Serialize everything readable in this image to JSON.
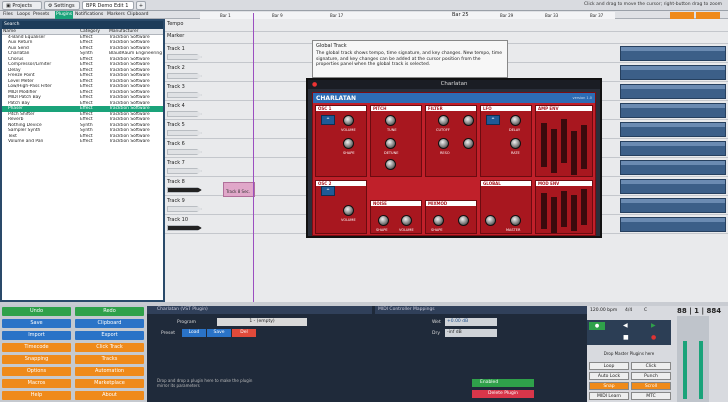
{
  "tabs": [
    {
      "label": "Projects"
    },
    {
      "label": "Settings"
    },
    {
      "label": "BPR Demo Edit 1"
    },
    {
      "label": "+"
    }
  ],
  "hint": "Click and drag to move the cursor; right-button drag to zoom",
  "subtabs": [
    "Files",
    "Loops",
    "Presets",
    "Plugins",
    "Notifications",
    "Markers",
    "Clipboard"
  ],
  "browser": {
    "search_label": "Search",
    "columns": [
      "Name",
      "Category",
      "Manufacturer"
    ],
    "rows": [
      [
        "4-Band Equaliser",
        "Effect",
        "Tracktion Software"
      ],
      [
        "Aux Return",
        "Effect",
        "Tracktion Software"
      ],
      [
        "Aux Send",
        "Effect",
        "Tracktion Software"
      ],
      [
        "Charlatan",
        "Synth",
        "BlaudRaum Engineering"
      ],
      [
        "Chorus",
        "Effect",
        "Tracktion Software"
      ],
      [
        "Compressor/Limiter",
        "Effect",
        "Tracktion Software"
      ],
      [
        "Delay",
        "Effect",
        "Tracktion Software"
      ],
      [
        "Freeze Point",
        "Effect",
        "Tracktion Software"
      ],
      [
        "Level Meter",
        "Effect",
        "Tracktion Software"
      ],
      [
        "Low/High-Pass Filter",
        "Effect",
        "Tracktion Software"
      ],
      [
        "MIDI Modifier",
        "Effect",
        "Tracktion Software"
      ],
      [
        "MIDI Patch Bay",
        "Effect",
        "Tracktion Software"
      ],
      [
        "Patch Bay",
        "Effect",
        "Tracktion Software"
      ],
      [
        "Phaser",
        "Effect",
        "Tracktion Software"
      ],
      [
        "Pitch Shifter",
        "Effect",
        "Tracktion Software"
      ],
      [
        "Reverb",
        "Effect",
        "Tracktion Software"
      ],
      [
        "Nothing Device",
        "Synth",
        "Tracktion Software"
      ],
      [
        "Sampler Synth",
        "Synth",
        "Tracktion Software"
      ],
      [
        "Text",
        "Effect",
        "Tracktion Software"
      ],
      [
        "Volume and Pan",
        "Effect",
        "Tracktion Software"
      ]
    ],
    "selected_index": 13
  },
  "ruler": {
    "bars": [
      "Bar 1",
      "Bar 9",
      "Bar 17",
      "Bar 25",
      "Bar 29",
      "Bar 33",
      "Bar 37"
    ]
  },
  "tracks": {
    "header_rows": [
      "Tempo",
      "Marker"
    ],
    "names": [
      "Track 1",
      "Track 2",
      "Track 3",
      "Track 4",
      "Track 5",
      "Track 6",
      "Track 7",
      "Track 8",
      "Track 9",
      "Track 10"
    ],
    "clip_name": "Track 8 Sec."
  },
  "tooltip": {
    "title": "Global Track",
    "body": "The global track shows tempo, time signature, and key changes. New tempo, time signature, and key changes can be added at the cursor position from the properties panel when the global track is selected."
  },
  "plugin": {
    "window_title": "Charlatan",
    "logo": "CHARLATAN",
    "version": "version 1.0",
    "sections": [
      "OSC 1",
      "PITCH",
      "FILTER",
      "LFO",
      "AMP ENV",
      "OSC 2",
      "NOISE",
      "MIXMOD",
      "GLOBAL",
      "MOD ENV"
    ],
    "knobs": [
      "VOLUME",
      "TUNE",
      "CUTOFF",
      "DELAY",
      "SHAPE",
      "DETUNE",
      "RESO",
      "RATE",
      "FM/SYNC",
      "WHEEL",
      "VOLUME",
      "SHAPE",
      "VOLUME",
      "SHAPE",
      "MASTER"
    ]
  },
  "bottom_buttons": {
    "left": [
      "Undo",
      "Save",
      "Import",
      "Timecode",
      "Snapping",
      "Options",
      "Macros",
      "Help"
    ],
    "right": [
      "Redo",
      "Clipboard",
      "Export",
      "Click Track",
      "Tracks",
      "Automation",
      "Marketplace",
      "About"
    ]
  },
  "bottom_mid": {
    "panel_title": "Charlatan (VST Plugin)",
    "program_label": "Program",
    "program_value": "1 - (empty)",
    "preset_label": "Preset",
    "preset_buttons": [
      "Load",
      "Save",
      "Del"
    ],
    "mapping_title": "MIDI Controller Mappings",
    "wet_label": "Wet",
    "wet_value": "+0.00 dB",
    "dry_label": "Dry",
    "dry_value": "-inf dB",
    "drop_text": "Drop and drop a plugin here to make the plugin mirror its parameters",
    "enabled_label": "Enabled",
    "delete_label": "Delete Plugin"
  },
  "transport": {
    "bpm": "120.00 bpm",
    "timesig": "4/4",
    "key": "C",
    "position": "88 | 1 | 884",
    "drop_text": "Drop Master Plugins here",
    "buttons": [
      "Loop",
      "Click",
      "Auto Lock",
      "Punch",
      "Snap",
      "Scroll",
      "MIDI Learn",
      "MTC"
    ]
  }
}
